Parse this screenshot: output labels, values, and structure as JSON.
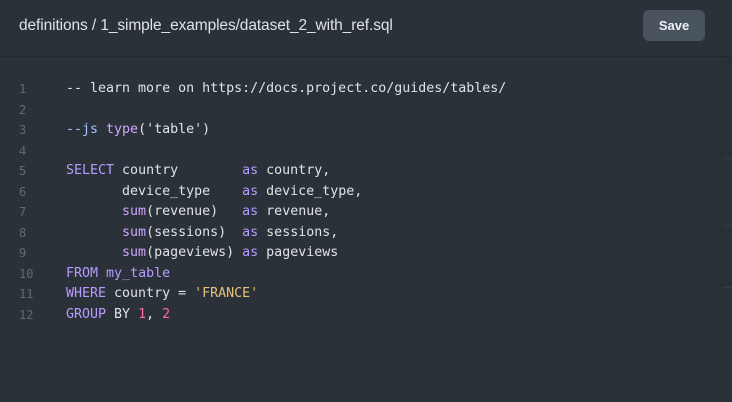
{
  "header": {
    "file_path": "definitions / 1_simple_examples/dataset_2_with_ref.sql",
    "save_label": "Save"
  },
  "editor": {
    "lines": [
      {
        "number": "1",
        "tokens": [
          {
            "t": "-- learn more on https://docs.project.co/guides/tables/",
            "c": "cm"
          }
        ]
      },
      {
        "number": "2",
        "tokens": []
      },
      {
        "number": "3",
        "tokens": [
          {
            "t": "--js ",
            "c": "js-comment"
          },
          {
            "t": "type",
            "c": "fn"
          },
          {
            "t": "(",
            "c": "cm"
          },
          {
            "t": "'table'",
            "c": "js-str"
          },
          {
            "t": ")",
            "c": "cm"
          }
        ]
      },
      {
        "number": "4",
        "tokens": []
      },
      {
        "number": "5",
        "tokens": [
          {
            "t": "SELECT",
            "c": "kw"
          },
          {
            "t": " country        ",
            "c": "cm"
          },
          {
            "t": "as",
            "c": "kw"
          },
          {
            "t": " country,",
            "c": "cm"
          }
        ]
      },
      {
        "number": "6",
        "tokens": [
          {
            "t": "       device_type    ",
            "c": "cm"
          },
          {
            "t": "as",
            "c": "kw"
          },
          {
            "t": " device_type,",
            "c": "cm"
          }
        ]
      },
      {
        "number": "7",
        "tokens": [
          {
            "t": "       ",
            "c": "cm"
          },
          {
            "t": "sum",
            "c": "fn"
          },
          {
            "t": "(revenue)   ",
            "c": "cm"
          },
          {
            "t": "as",
            "c": "kw"
          },
          {
            "t": " revenue,",
            "c": "cm"
          }
        ]
      },
      {
        "number": "8",
        "tokens": [
          {
            "t": "       ",
            "c": "cm"
          },
          {
            "t": "sum",
            "c": "fn"
          },
          {
            "t": "(sessions)  ",
            "c": "cm"
          },
          {
            "t": "as",
            "c": "kw"
          },
          {
            "t": " sessions,",
            "c": "cm"
          }
        ]
      },
      {
        "number": "9",
        "tokens": [
          {
            "t": "       ",
            "c": "cm"
          },
          {
            "t": "sum",
            "c": "fn"
          },
          {
            "t": "(pageviews) ",
            "c": "cm"
          },
          {
            "t": "as",
            "c": "kw"
          },
          {
            "t": " pageviews",
            "c": "cm"
          }
        ]
      },
      {
        "number": "10",
        "tokens": [
          {
            "t": "FROM",
            "c": "kw"
          },
          {
            "t": " ",
            "c": "cm"
          },
          {
            "t": "my_table",
            "c": "tbl"
          }
        ]
      },
      {
        "number": "11",
        "tokens": [
          {
            "t": "WHERE",
            "c": "kw"
          },
          {
            "t": " country = ",
            "c": "cm"
          },
          {
            "t": "'FRANCE'",
            "c": "str"
          }
        ]
      },
      {
        "number": "12",
        "tokens": [
          {
            "t": "GROUP",
            "c": "kw"
          },
          {
            "t": " BY ",
            "c": "cm"
          },
          {
            "t": "1",
            "c": "num"
          },
          {
            "t": ", ",
            "c": "cm"
          },
          {
            "t": "2",
            "c": "num"
          }
        ]
      }
    ]
  },
  "colors": {
    "background": "#2b3139",
    "keyword": "#b79cff",
    "string": "#e6c07b",
    "number": "#ff6e9c",
    "line_number": "#5f6a76",
    "save_button": "#4a545f"
  }
}
